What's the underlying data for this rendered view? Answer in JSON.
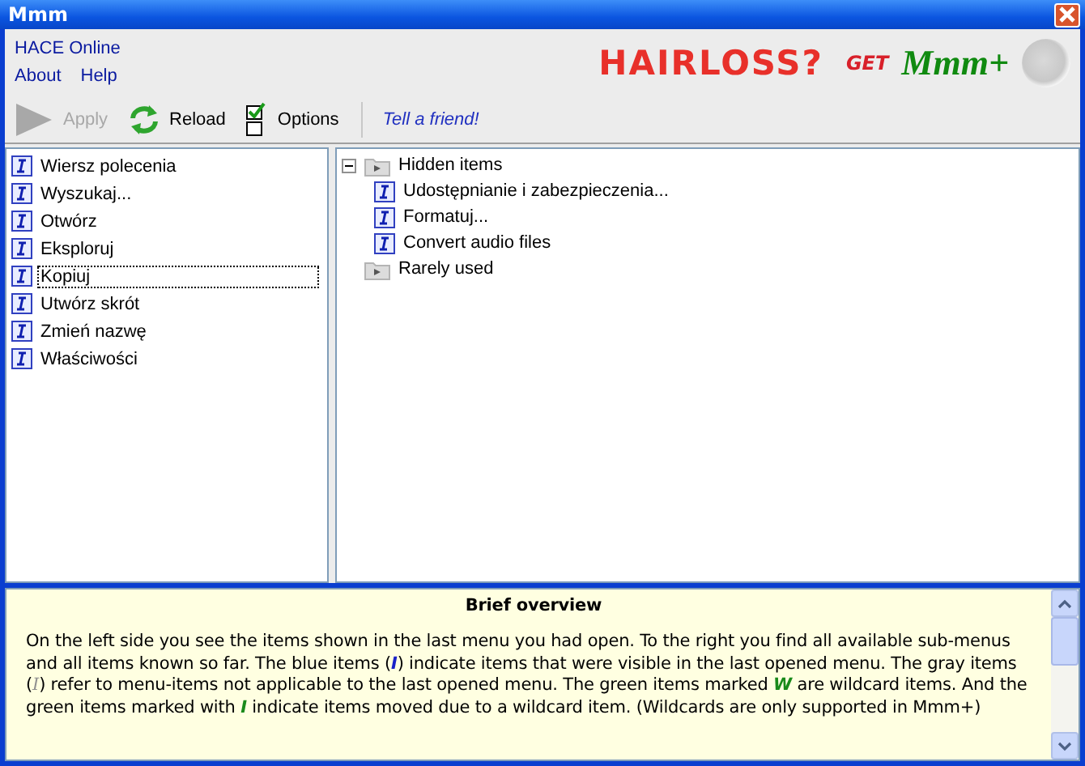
{
  "window": {
    "title": "Mmm"
  },
  "menu": {
    "top": "HACE Online",
    "items": [
      "About",
      "Help"
    ]
  },
  "banner": {
    "headline": "HAIRLOSS?",
    "call": "GET",
    "brand": "Mmm+"
  },
  "toolbar": [
    {
      "kind": "apply",
      "label": "Apply",
      "disabled": true
    },
    {
      "kind": "reload",
      "label": "Reload",
      "disabled": false
    },
    {
      "kind": "options",
      "label": "Options",
      "disabled": false
    },
    {
      "kind": "link",
      "label": "Tell a friend!"
    }
  ],
  "left_items": [
    {
      "label": "Wiersz polecenia",
      "selected": false
    },
    {
      "label": "Wyszukaj...",
      "selected": false
    },
    {
      "label": "Otwórz",
      "selected": false
    },
    {
      "label": "Eksploruj",
      "selected": false
    },
    {
      "label": "Kopiuj",
      "selected": true
    },
    {
      "label": "Utwórz skrót",
      "selected": false
    },
    {
      "label": "Zmień nazwę",
      "selected": false
    },
    {
      "label": "Właściwości",
      "selected": false
    }
  ],
  "tree": [
    {
      "kind": "folder",
      "label": "Hidden items",
      "expanded": true,
      "children": [
        {
          "kind": "item",
          "label": "Udostępnianie i zabezpieczenia..."
        },
        {
          "kind": "item",
          "label": "Formatuj..."
        },
        {
          "kind": "item",
          "label": "Convert audio files"
        }
      ]
    },
    {
      "kind": "folder",
      "label": "Rarely used"
    }
  ],
  "overview": {
    "title": "Brief overview",
    "text": "On the left side you see the items shown in the last menu you had open. To the right you find all available sub-menus and all items known so far. The blue items (**I**) indicate items that were visible in the last opened menu. The gray items (**I**) refer to menu-items not applicable to the last opened menu. The green items marked **W** are wildcard items. And the green items marked with **I** indicate items moved due to a wildcard item. (Wildcards are only supported in Mmm+)"
  }
}
